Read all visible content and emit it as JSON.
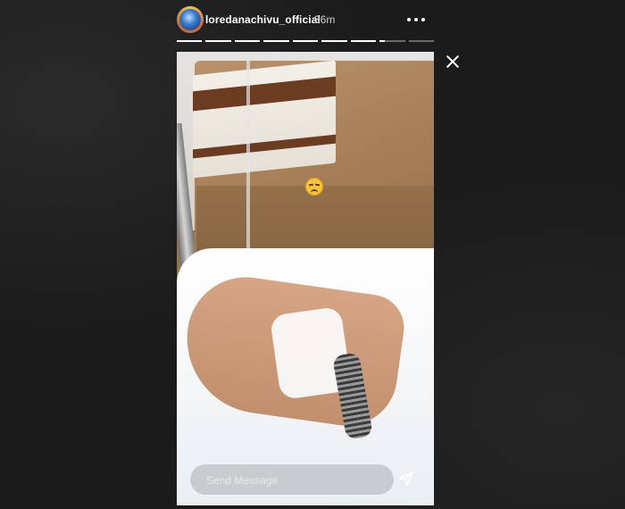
{
  "header": {
    "username": "loredanachivu_official",
    "timestamp": "36m",
    "more_icon": "more-horizontal-icon",
    "avatar_icon": "profile-avatar"
  },
  "progress": {
    "segments": [
      1,
      1,
      1,
      1,
      1,
      1,
      1,
      0.2,
      0
    ]
  },
  "story": {
    "emoji": "😔"
  },
  "message": {
    "placeholder": "Send Message",
    "send_icon": "send-icon"
  },
  "colors": {
    "background": "#1a1a1a",
    "text": "#ffffff"
  }
}
